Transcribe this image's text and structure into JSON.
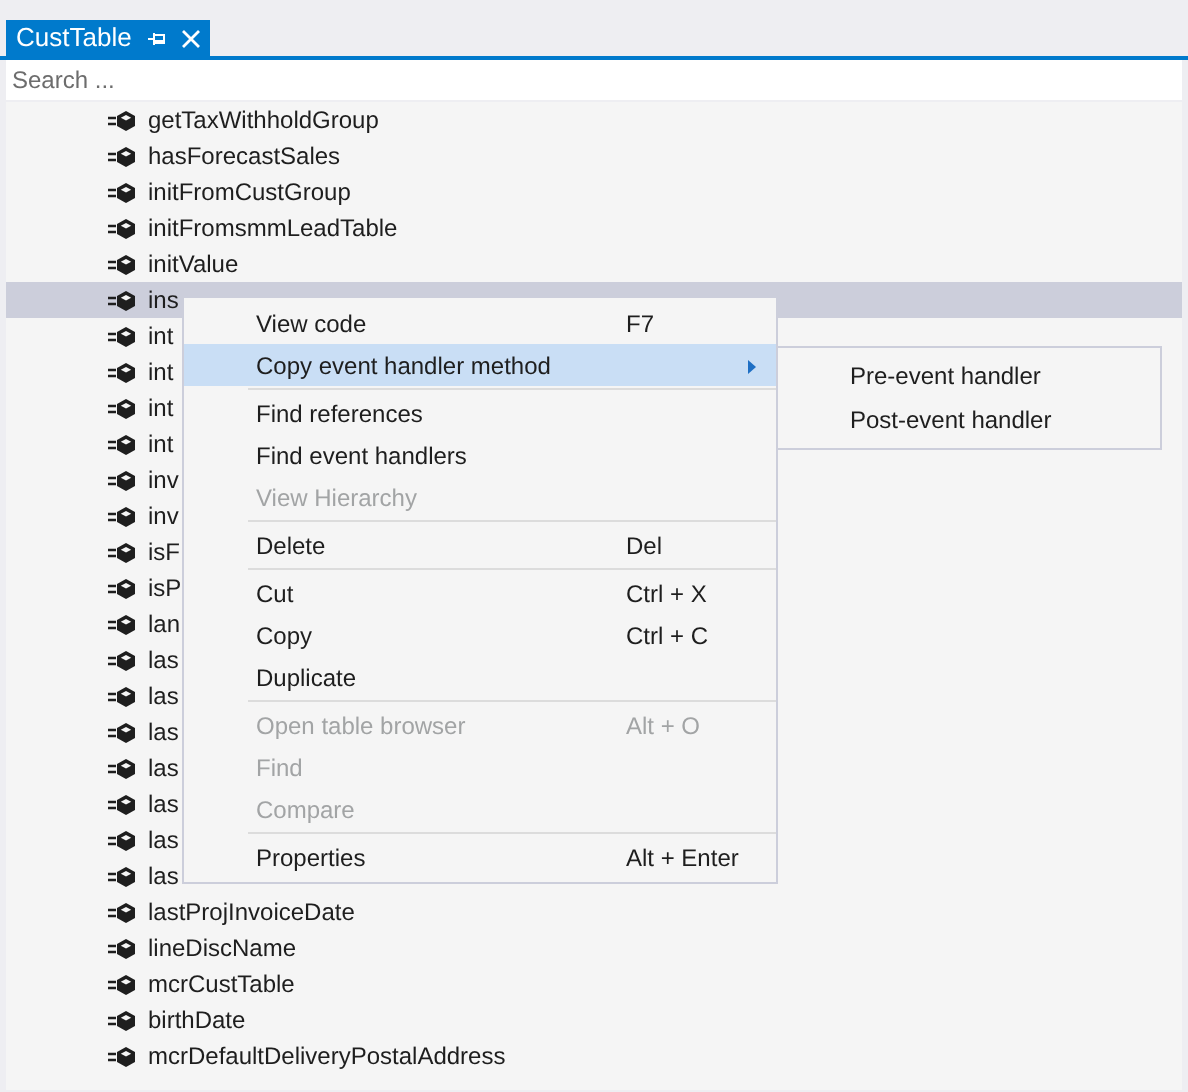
{
  "tab": {
    "title": "CustTable"
  },
  "search": {
    "placeholder": "Search ..."
  },
  "tree": {
    "rows": [
      {
        "label": "getTaxWithholdGroup",
        "selected": false
      },
      {
        "label": "hasForecastSales",
        "selected": false
      },
      {
        "label": "initFromCustGroup",
        "selected": false
      },
      {
        "label": "initFromsmmLeadTable",
        "selected": false
      },
      {
        "label": "initValue",
        "selected": false
      },
      {
        "label": "ins",
        "selected": true
      },
      {
        "label": "int",
        "selected": false
      },
      {
        "label": "int",
        "selected": false
      },
      {
        "label": "int",
        "selected": false
      },
      {
        "label": "int",
        "selected": false
      },
      {
        "label": "inv",
        "selected": false
      },
      {
        "label": "inv",
        "selected": false
      },
      {
        "label": "isF",
        "selected": false
      },
      {
        "label": "isP",
        "selected": false
      },
      {
        "label": "lan",
        "selected": false
      },
      {
        "label": "las",
        "selected": false
      },
      {
        "label": "las",
        "selected": false
      },
      {
        "label": "las",
        "selected": false
      },
      {
        "label": "las",
        "selected": false
      },
      {
        "label": "las",
        "selected": false
      },
      {
        "label": "las",
        "selected": false
      },
      {
        "label": "las",
        "selected": false
      },
      {
        "label": "lastProjInvoiceDate",
        "selected": false
      },
      {
        "label": "lineDiscName",
        "selected": false
      },
      {
        "label": "mcrCustTable",
        "selected": false
      },
      {
        "label": "birthDate",
        "selected": false
      },
      {
        "label": "mcrDefaultDeliveryPostalAddress",
        "selected": false
      }
    ]
  },
  "context_menu": {
    "items": [
      {
        "kind": "item",
        "label": "View code",
        "shortcut": "F7",
        "disabled": false,
        "selected": false
      },
      {
        "kind": "item",
        "label": "Copy event handler method",
        "disabled": false,
        "selected": true,
        "has_submenu": true
      },
      {
        "kind": "separator"
      },
      {
        "kind": "item",
        "label": "Find references",
        "disabled": false,
        "selected": false
      },
      {
        "kind": "item",
        "label": "Find event handlers",
        "disabled": false,
        "selected": false
      },
      {
        "kind": "item",
        "label": "View Hierarchy",
        "disabled": true,
        "selected": false
      },
      {
        "kind": "separator"
      },
      {
        "kind": "item",
        "label": "Delete",
        "shortcut": "Del",
        "disabled": false,
        "selected": false
      },
      {
        "kind": "separator"
      },
      {
        "kind": "item",
        "label": "Cut",
        "shortcut": "Ctrl + X",
        "disabled": false,
        "selected": false
      },
      {
        "kind": "item",
        "label": "Copy",
        "shortcut": "Ctrl + C",
        "disabled": false,
        "selected": false
      },
      {
        "kind": "item",
        "label": "Duplicate",
        "disabled": false,
        "selected": false
      },
      {
        "kind": "separator"
      },
      {
        "kind": "item",
        "label": "Open table browser",
        "shortcut": "Alt + O",
        "disabled": true,
        "selected": false
      },
      {
        "kind": "item",
        "label": "Find",
        "disabled": true,
        "selected": false
      },
      {
        "kind": "item",
        "label": "Compare",
        "disabled": true,
        "selected": false
      },
      {
        "kind": "separator"
      },
      {
        "kind": "item",
        "label": "Properties",
        "shortcut": "Alt + Enter",
        "disabled": false,
        "selected": false
      }
    ]
  },
  "submenu": {
    "items": [
      {
        "label": "Pre-event handler",
        "selected": false
      },
      {
        "label": "Post-event handler",
        "selected": false
      }
    ]
  }
}
